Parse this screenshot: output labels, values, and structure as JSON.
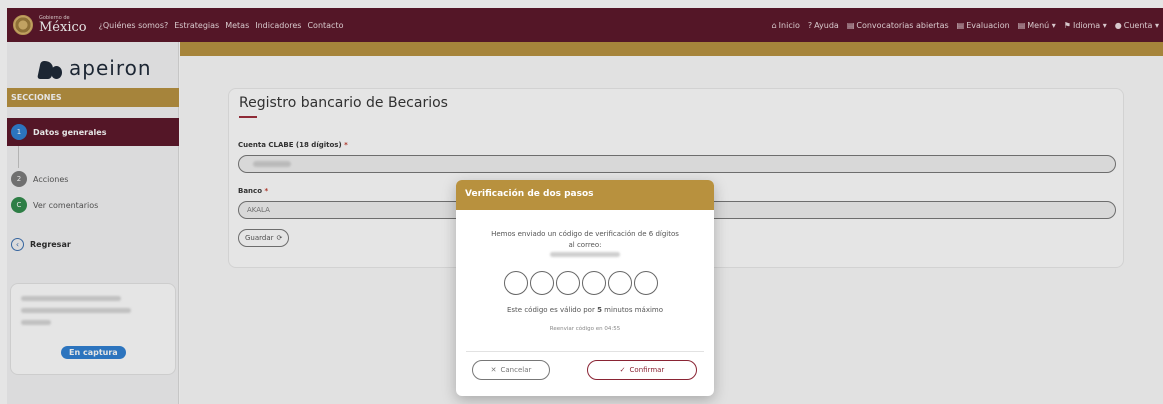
{
  "header": {
    "brand_small": "Gobierno de",
    "brand_big": "México",
    "nav_left": [
      "¿Quiénes somos?",
      "Estrategias",
      "Metas",
      "Indicadores",
      "Contacto"
    ],
    "nav_right": [
      {
        "icon": "home-icon",
        "glyph": "⌂",
        "label": "Inicio"
      },
      {
        "icon": "help-icon",
        "glyph": "?",
        "label": "Ayuda"
      },
      {
        "icon": "list-icon",
        "glyph": "▤",
        "label": "Convocatorias abiertas"
      },
      {
        "icon": "clipboard-icon",
        "glyph": "▤",
        "label": "Evaluacion"
      },
      {
        "icon": "menu-icon",
        "glyph": "▤",
        "label": "Menú ▾"
      },
      {
        "icon": "flag-icon",
        "glyph": "⚑",
        "label": "Idioma ▾"
      },
      {
        "icon": "user-icon",
        "glyph": "●",
        "label": "Cuenta ▾"
      }
    ]
  },
  "sidebar": {
    "logo_text": "apeiron",
    "sections_label": "SECCIONES",
    "steps": [
      {
        "number": "1",
        "label": "Datos generales"
      },
      {
        "number": "2",
        "label": "Acciones"
      },
      {
        "number": "C",
        "label": "Ver comentarios"
      }
    ],
    "back_label": "Regresar",
    "status_badge": "En captura"
  },
  "main": {
    "title": "Registro bancario de Becarios",
    "clabe_label": "Cuenta CLABE (18 dígitos)",
    "bank_label": "Banco",
    "bank_value": "AKALA",
    "save_label": "Guardar"
  },
  "modal": {
    "title": "Verificación de dos pasos",
    "message_line1": "Hemos enviado un código de verificación de 6 dígitos",
    "message_line2": "al correo:",
    "validity_prefix": "Este código es válido por ",
    "validity_minutes": "5",
    "validity_suffix": " minutos máximo",
    "resend": "Reenviar código en 04:55",
    "cancel_label": "Cancelar",
    "confirm_label": "Confirmar"
  },
  "colors": {
    "header_bg": "#5a1427",
    "accent_gold": "#b8913e",
    "active_step_bg": "#5a1427",
    "badge_blue": "#2d7fd3"
  }
}
